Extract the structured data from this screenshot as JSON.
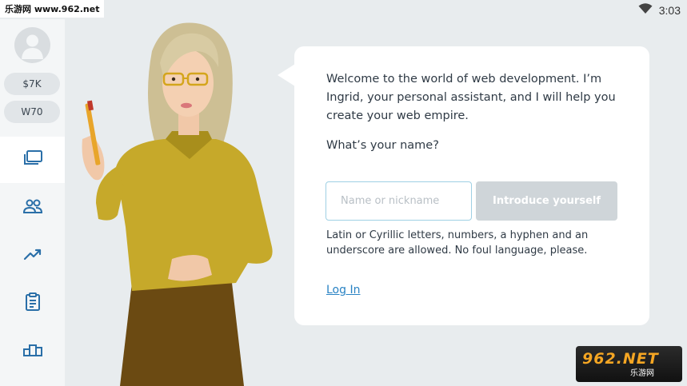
{
  "status_bar": {
    "watermark": "乐游网 www.962.net",
    "time": "3:03",
    "icons": [
      "wifi-icon"
    ]
  },
  "sidebar": {
    "avatar_icon": "user-avatar-icon",
    "currency_1": "$7K",
    "currency_2": "W70",
    "nav": [
      {
        "icon": "projects-window-icon",
        "active": true
      },
      {
        "icon": "team-people-icon",
        "active": false
      },
      {
        "icon": "stats-trending-icon",
        "active": false
      },
      {
        "icon": "tasks-clipboard-icon",
        "active": false
      },
      {
        "icon": "ranking-podium-icon",
        "active": false
      }
    ]
  },
  "dialog": {
    "welcome_text": "Welcome to the world of web development. I’m Ingrid, your personal assistant, and I will help you create your web empire.",
    "question": "What’s your name?",
    "name_placeholder": "Name or nickname",
    "name_value": "",
    "introduce_button": "Introduce yourself",
    "hint": "Latin or Cyrillic letters, numbers, a hyphen and an underscore are allowed. No foul language, please.",
    "login_link": "Log In"
  },
  "watermark_bottom": {
    "main": "962.NET",
    "sub": "乐游网"
  },
  "colors": {
    "background": "#e8ecee",
    "sidebar": "#f4f6f7",
    "accent_link": "#2a83c4",
    "input_border": "#9fd0e4",
    "button_disabled": "#cfd5d9",
    "icon_blue": "#2a6fa8"
  }
}
